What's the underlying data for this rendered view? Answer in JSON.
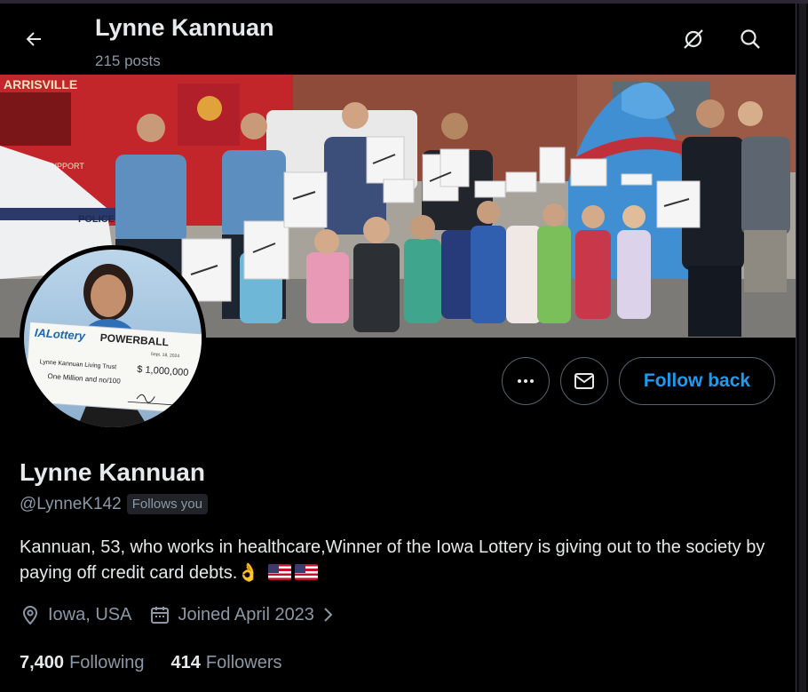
{
  "header": {
    "title": "Lynne Kannuan",
    "posts": "215 posts"
  },
  "profile": {
    "name": "Lynne Kannuan",
    "handle": "@LynneK142",
    "follows_badge": "Follows you",
    "bio_text": "Kannuan, 53, who works in healthcare,Winner of the Iowa Lottery is giving out to the society by paying off credit card debts.",
    "location": "Iowa, USA",
    "joined": "Joined April 2023",
    "following_count": "7,400",
    "following_label": "Following",
    "followers_count": "414",
    "followers_label": "Followers"
  },
  "actions": {
    "follow_back": "Follow back"
  },
  "avatar_check": {
    "brand": "IALottery",
    "game": "POWERBALL",
    "payee": "Lynne Kannuan Living Trust",
    "amount": "$ 1,000,000",
    "amount_words": "One Million and no/100",
    "date": "Sept. 18, 2024"
  },
  "banner_signs": {
    "truck_text": "ARRISVILLE",
    "truck_text2": "LIFE SUPPORT",
    "car_text": "POLICE"
  },
  "colors": {
    "accent": "#1d9bf0",
    "background": "#000000",
    "text_primary": "#e7e9ea",
    "text_secondary": "#8b98a5"
  },
  "icons": [
    "back-arrow-icon",
    "no-grok-icon",
    "search-icon",
    "more-icon",
    "mail-icon",
    "location-icon",
    "calendar-icon",
    "chevron-right-icon"
  ]
}
